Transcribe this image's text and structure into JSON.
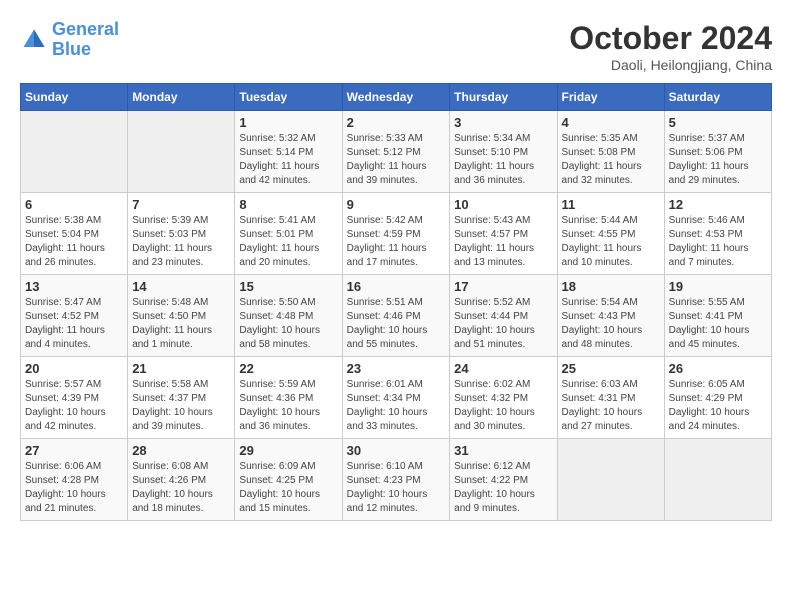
{
  "header": {
    "logo_line1": "General",
    "logo_line2": "Blue",
    "month": "October 2024",
    "location": "Daoli, Heilongjiang, China"
  },
  "days_of_week": [
    "Sunday",
    "Monday",
    "Tuesday",
    "Wednesday",
    "Thursday",
    "Friday",
    "Saturday"
  ],
  "weeks": [
    [
      {
        "day": "",
        "sunrise": "",
        "sunset": "",
        "daylight": ""
      },
      {
        "day": "",
        "sunrise": "",
        "sunset": "",
        "daylight": ""
      },
      {
        "day": "1",
        "sunrise": "Sunrise: 5:32 AM",
        "sunset": "Sunset: 5:14 PM",
        "daylight": "Daylight: 11 hours and 42 minutes."
      },
      {
        "day": "2",
        "sunrise": "Sunrise: 5:33 AM",
        "sunset": "Sunset: 5:12 PM",
        "daylight": "Daylight: 11 hours and 39 minutes."
      },
      {
        "day": "3",
        "sunrise": "Sunrise: 5:34 AM",
        "sunset": "Sunset: 5:10 PM",
        "daylight": "Daylight: 11 hours and 36 minutes."
      },
      {
        "day": "4",
        "sunrise": "Sunrise: 5:35 AM",
        "sunset": "Sunset: 5:08 PM",
        "daylight": "Daylight: 11 hours and 32 minutes."
      },
      {
        "day": "5",
        "sunrise": "Sunrise: 5:37 AM",
        "sunset": "Sunset: 5:06 PM",
        "daylight": "Daylight: 11 hours and 29 minutes."
      }
    ],
    [
      {
        "day": "6",
        "sunrise": "Sunrise: 5:38 AM",
        "sunset": "Sunset: 5:04 PM",
        "daylight": "Daylight: 11 hours and 26 minutes."
      },
      {
        "day": "7",
        "sunrise": "Sunrise: 5:39 AM",
        "sunset": "Sunset: 5:03 PM",
        "daylight": "Daylight: 11 hours and 23 minutes."
      },
      {
        "day": "8",
        "sunrise": "Sunrise: 5:41 AM",
        "sunset": "Sunset: 5:01 PM",
        "daylight": "Daylight: 11 hours and 20 minutes."
      },
      {
        "day": "9",
        "sunrise": "Sunrise: 5:42 AM",
        "sunset": "Sunset: 4:59 PM",
        "daylight": "Daylight: 11 hours and 17 minutes."
      },
      {
        "day": "10",
        "sunrise": "Sunrise: 5:43 AM",
        "sunset": "Sunset: 4:57 PM",
        "daylight": "Daylight: 11 hours and 13 minutes."
      },
      {
        "day": "11",
        "sunrise": "Sunrise: 5:44 AM",
        "sunset": "Sunset: 4:55 PM",
        "daylight": "Daylight: 11 hours and 10 minutes."
      },
      {
        "day": "12",
        "sunrise": "Sunrise: 5:46 AM",
        "sunset": "Sunset: 4:53 PM",
        "daylight": "Daylight: 11 hours and 7 minutes."
      }
    ],
    [
      {
        "day": "13",
        "sunrise": "Sunrise: 5:47 AM",
        "sunset": "Sunset: 4:52 PM",
        "daylight": "Daylight: 11 hours and 4 minutes."
      },
      {
        "day": "14",
        "sunrise": "Sunrise: 5:48 AM",
        "sunset": "Sunset: 4:50 PM",
        "daylight": "Daylight: 11 hours and 1 minute."
      },
      {
        "day": "15",
        "sunrise": "Sunrise: 5:50 AM",
        "sunset": "Sunset: 4:48 PM",
        "daylight": "Daylight: 10 hours and 58 minutes."
      },
      {
        "day": "16",
        "sunrise": "Sunrise: 5:51 AM",
        "sunset": "Sunset: 4:46 PM",
        "daylight": "Daylight: 10 hours and 55 minutes."
      },
      {
        "day": "17",
        "sunrise": "Sunrise: 5:52 AM",
        "sunset": "Sunset: 4:44 PM",
        "daylight": "Daylight: 10 hours and 51 minutes."
      },
      {
        "day": "18",
        "sunrise": "Sunrise: 5:54 AM",
        "sunset": "Sunset: 4:43 PM",
        "daylight": "Daylight: 10 hours and 48 minutes."
      },
      {
        "day": "19",
        "sunrise": "Sunrise: 5:55 AM",
        "sunset": "Sunset: 4:41 PM",
        "daylight": "Daylight: 10 hours and 45 minutes."
      }
    ],
    [
      {
        "day": "20",
        "sunrise": "Sunrise: 5:57 AM",
        "sunset": "Sunset: 4:39 PM",
        "daylight": "Daylight: 10 hours and 42 minutes."
      },
      {
        "day": "21",
        "sunrise": "Sunrise: 5:58 AM",
        "sunset": "Sunset: 4:37 PM",
        "daylight": "Daylight: 10 hours and 39 minutes."
      },
      {
        "day": "22",
        "sunrise": "Sunrise: 5:59 AM",
        "sunset": "Sunset: 4:36 PM",
        "daylight": "Daylight: 10 hours and 36 minutes."
      },
      {
        "day": "23",
        "sunrise": "Sunrise: 6:01 AM",
        "sunset": "Sunset: 4:34 PM",
        "daylight": "Daylight: 10 hours and 33 minutes."
      },
      {
        "day": "24",
        "sunrise": "Sunrise: 6:02 AM",
        "sunset": "Sunset: 4:32 PM",
        "daylight": "Daylight: 10 hours and 30 minutes."
      },
      {
        "day": "25",
        "sunrise": "Sunrise: 6:03 AM",
        "sunset": "Sunset: 4:31 PM",
        "daylight": "Daylight: 10 hours and 27 minutes."
      },
      {
        "day": "26",
        "sunrise": "Sunrise: 6:05 AM",
        "sunset": "Sunset: 4:29 PM",
        "daylight": "Daylight: 10 hours and 24 minutes."
      }
    ],
    [
      {
        "day": "27",
        "sunrise": "Sunrise: 6:06 AM",
        "sunset": "Sunset: 4:28 PM",
        "daylight": "Daylight: 10 hours and 21 minutes."
      },
      {
        "day": "28",
        "sunrise": "Sunrise: 6:08 AM",
        "sunset": "Sunset: 4:26 PM",
        "daylight": "Daylight: 10 hours and 18 minutes."
      },
      {
        "day": "29",
        "sunrise": "Sunrise: 6:09 AM",
        "sunset": "Sunset: 4:25 PM",
        "daylight": "Daylight: 10 hours and 15 minutes."
      },
      {
        "day": "30",
        "sunrise": "Sunrise: 6:10 AM",
        "sunset": "Sunset: 4:23 PM",
        "daylight": "Daylight: 10 hours and 12 minutes."
      },
      {
        "day": "31",
        "sunrise": "Sunrise: 6:12 AM",
        "sunset": "Sunset: 4:22 PM",
        "daylight": "Daylight: 10 hours and 9 minutes."
      },
      {
        "day": "",
        "sunrise": "",
        "sunset": "",
        "daylight": ""
      },
      {
        "day": "",
        "sunrise": "",
        "sunset": "",
        "daylight": ""
      }
    ]
  ]
}
